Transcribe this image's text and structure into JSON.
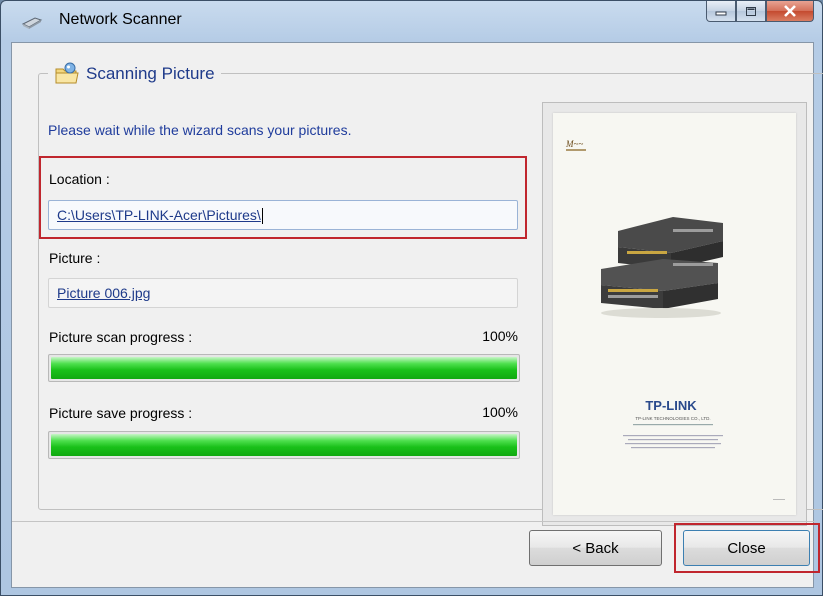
{
  "window": {
    "title": "Network Scanner"
  },
  "group": {
    "title": "Scanning Picture"
  },
  "wait_message": "Please wait while the wizard scans your pictures.",
  "location": {
    "label": "Location :",
    "value": "C:\\Users\\TP-LINK-Acer\\Pictures\\"
  },
  "picture": {
    "label": "Picture :",
    "value": "Picture 006.jpg"
  },
  "scan_progress": {
    "label": "Picture scan progress :",
    "percent": "100%",
    "value": 1.0
  },
  "save_progress": {
    "label": "Picture save progress :",
    "percent": "100%",
    "value": 1.0
  },
  "preview": {
    "logo_text": "TP-LINK",
    "company_text": "TP-LINK TECHNOLOGIES CO., LTD."
  },
  "buttons": {
    "back": "< Back",
    "close": "Close"
  },
  "colors": {
    "highlight": "#c0262e",
    "progress": "#19c019",
    "link": "#1e3a8a"
  }
}
